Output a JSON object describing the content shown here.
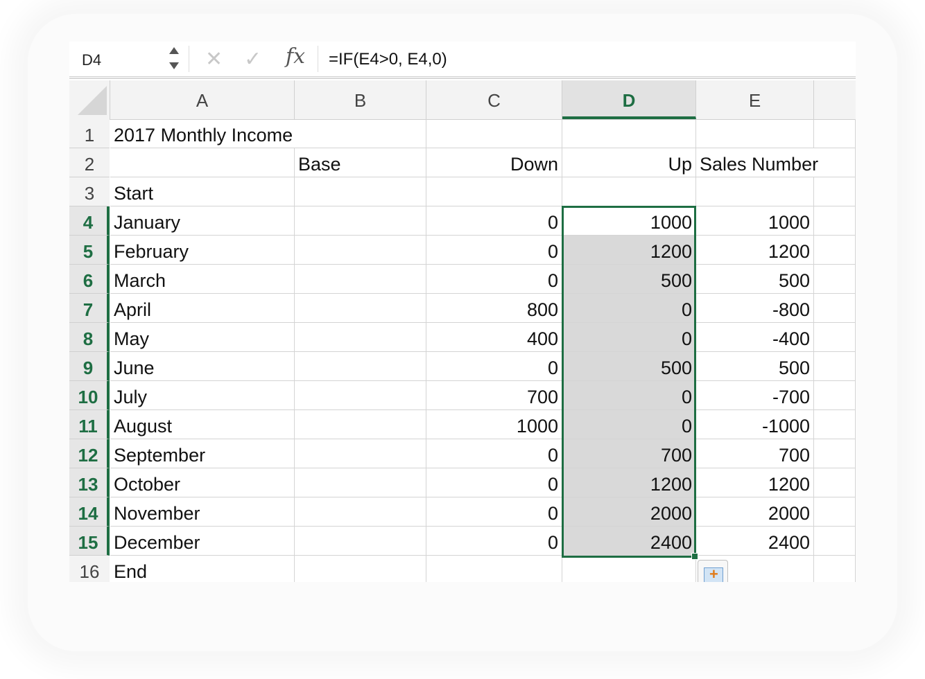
{
  "formula_bar": {
    "name_box": "D4",
    "cancel_icon": "x-icon",
    "enter_icon": "checkmark-icon",
    "fx_label": "fx",
    "formula": "=IF(E4>0, E4,0)"
  },
  "columns": [
    "A",
    "B",
    "C",
    "D",
    "E"
  ],
  "selected_column": "D",
  "rows": [
    {
      "n": "1",
      "a": "2017 Monthly Income",
      "b": "",
      "c": "",
      "d": "",
      "e": ""
    },
    {
      "n": "2",
      "a": "",
      "b": "Base",
      "c": "Down",
      "d": "Up",
      "e": "Sales Number"
    },
    {
      "n": "3",
      "a": "Start",
      "b": "",
      "c": "",
      "d": "",
      "e": ""
    },
    {
      "n": "4",
      "a": "January",
      "b": "",
      "c": "0",
      "d": "1000",
      "e": "1000"
    },
    {
      "n": "5",
      "a": "February",
      "b": "",
      "c": "0",
      "d": "1200",
      "e": "1200"
    },
    {
      "n": "6",
      "a": "March",
      "b": "",
      "c": "0",
      "d": "500",
      "e": "500"
    },
    {
      "n": "7",
      "a": "April",
      "b": "",
      "c": "800",
      "d": "0",
      "e": "-800"
    },
    {
      "n": "8",
      "a": "May",
      "b": "",
      "c": "400",
      "d": "0",
      "e": "-400"
    },
    {
      "n": "9",
      "a": "June",
      "b": "",
      "c": "0",
      "d": "500",
      "e": "500"
    },
    {
      "n": "10",
      "a": "July",
      "b": "",
      "c": "700",
      "d": "0",
      "e": "-700"
    },
    {
      "n": "11",
      "a": "August",
      "b": "",
      "c": "1000",
      "d": "0",
      "e": "-1000"
    },
    {
      "n": "12",
      "a": "September",
      "b": "",
      "c": "0",
      "d": "700",
      "e": "700"
    },
    {
      "n": "13",
      "a": "October",
      "b": "",
      "c": "0",
      "d": "1200",
      "e": "1200"
    },
    {
      "n": "14",
      "a": "November",
      "b": "",
      "c": "0",
      "d": "2000",
      "e": "2000"
    },
    {
      "n": "15",
      "a": "December",
      "b": "",
      "c": "0",
      "d": "2400",
      "e": "2400"
    },
    {
      "n": "16",
      "a": "End",
      "b": "",
      "c": "",
      "d": "",
      "e": ""
    }
  ],
  "selection": {
    "range": "D4:D15",
    "active_cell": "D4"
  },
  "colors": {
    "accent": "#1e6e43",
    "selection_fill": "#d9d9d9",
    "header_bg": "#f3f3f3"
  },
  "quick_analysis_icon": "quick-analysis-icon"
}
